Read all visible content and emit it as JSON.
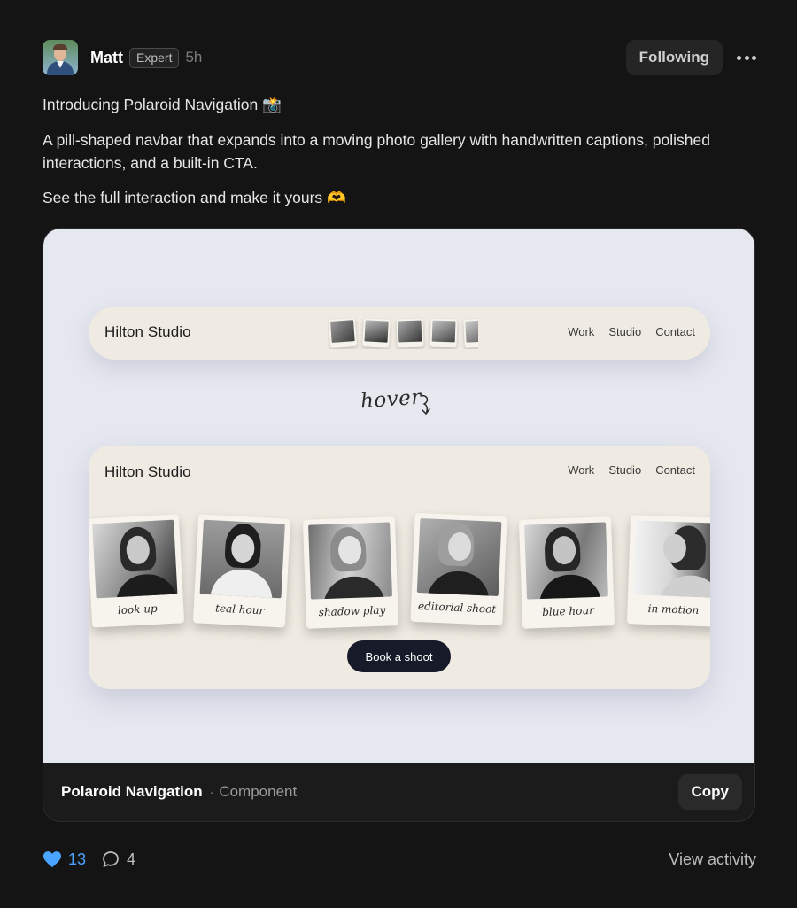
{
  "post": {
    "author": {
      "name": "Matt",
      "badge": "Expert",
      "time": "5h"
    },
    "follow_label": "Following",
    "more_icon": "more-horizontal-icon",
    "paragraphs": {
      "p1": "Introducing Polaroid Navigation 📸",
      "p2": "A pill-shaped navbar that expands into a moving photo gallery with handwritten captions, polished interactions, and a built-in CTA.",
      "p3": "See the full interaction and make it yours 🫶"
    }
  },
  "preview": {
    "background": "#e6e8f0",
    "collapsed_nav": {
      "brand": "Hilton Studio",
      "links": {
        "work": "Work",
        "studio": "Studio",
        "contact": "Contact"
      }
    },
    "hover_note": "hover",
    "expanded_nav": {
      "brand": "Hilton Studio",
      "links": {
        "work": "Work",
        "studio": "Studio",
        "contact": "Contact"
      },
      "captions": [
        "look up",
        "teal hour",
        "shadow play",
        "editorial shoot",
        "blue hour",
        "in motion"
      ],
      "cta_label": "Book a shoot",
      "cta_color": "#161a29"
    }
  },
  "card_footer": {
    "component_name": "Polaroid Navigation",
    "separator": "·",
    "component_type": "Component",
    "copy_label": "Copy"
  },
  "reactions": {
    "likes": "13",
    "comments": "4",
    "view_activity": "View activity",
    "like_color": "#4aa3ff"
  }
}
